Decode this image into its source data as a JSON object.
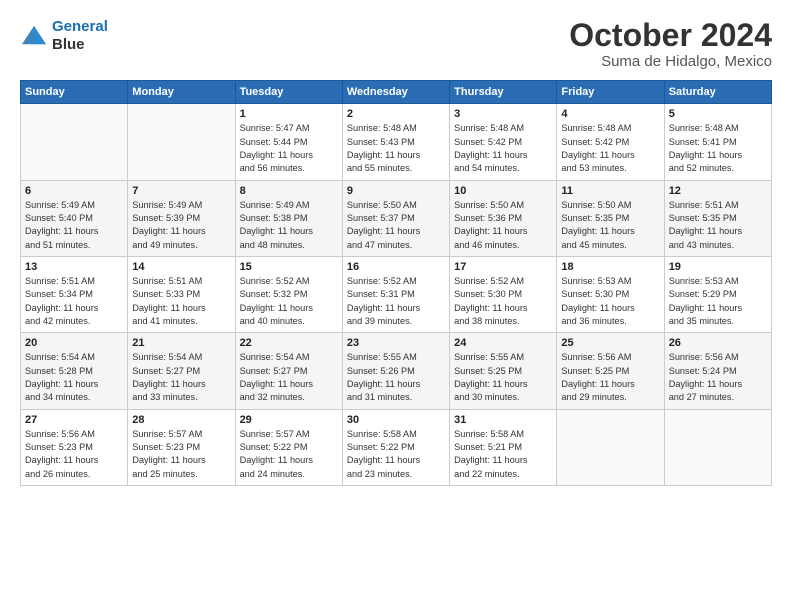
{
  "header": {
    "logo_line1": "General",
    "logo_line2": "Blue",
    "month": "October 2024",
    "location": "Suma de Hidalgo, Mexico"
  },
  "columns": [
    "Sunday",
    "Monday",
    "Tuesday",
    "Wednesday",
    "Thursday",
    "Friday",
    "Saturday"
  ],
  "weeks": [
    [
      {
        "num": "",
        "info": ""
      },
      {
        "num": "",
        "info": ""
      },
      {
        "num": "1",
        "info": "Sunrise: 5:47 AM\nSunset: 5:44 PM\nDaylight: 11 hours\nand 56 minutes."
      },
      {
        "num": "2",
        "info": "Sunrise: 5:48 AM\nSunset: 5:43 PM\nDaylight: 11 hours\nand 55 minutes."
      },
      {
        "num": "3",
        "info": "Sunrise: 5:48 AM\nSunset: 5:42 PM\nDaylight: 11 hours\nand 54 minutes."
      },
      {
        "num": "4",
        "info": "Sunrise: 5:48 AM\nSunset: 5:42 PM\nDaylight: 11 hours\nand 53 minutes."
      },
      {
        "num": "5",
        "info": "Sunrise: 5:48 AM\nSunset: 5:41 PM\nDaylight: 11 hours\nand 52 minutes."
      }
    ],
    [
      {
        "num": "6",
        "info": "Sunrise: 5:49 AM\nSunset: 5:40 PM\nDaylight: 11 hours\nand 51 minutes."
      },
      {
        "num": "7",
        "info": "Sunrise: 5:49 AM\nSunset: 5:39 PM\nDaylight: 11 hours\nand 49 minutes."
      },
      {
        "num": "8",
        "info": "Sunrise: 5:49 AM\nSunset: 5:38 PM\nDaylight: 11 hours\nand 48 minutes."
      },
      {
        "num": "9",
        "info": "Sunrise: 5:50 AM\nSunset: 5:37 PM\nDaylight: 11 hours\nand 47 minutes."
      },
      {
        "num": "10",
        "info": "Sunrise: 5:50 AM\nSunset: 5:36 PM\nDaylight: 11 hours\nand 46 minutes."
      },
      {
        "num": "11",
        "info": "Sunrise: 5:50 AM\nSunset: 5:35 PM\nDaylight: 11 hours\nand 45 minutes."
      },
      {
        "num": "12",
        "info": "Sunrise: 5:51 AM\nSunset: 5:35 PM\nDaylight: 11 hours\nand 43 minutes."
      }
    ],
    [
      {
        "num": "13",
        "info": "Sunrise: 5:51 AM\nSunset: 5:34 PM\nDaylight: 11 hours\nand 42 minutes."
      },
      {
        "num": "14",
        "info": "Sunrise: 5:51 AM\nSunset: 5:33 PM\nDaylight: 11 hours\nand 41 minutes."
      },
      {
        "num": "15",
        "info": "Sunrise: 5:52 AM\nSunset: 5:32 PM\nDaylight: 11 hours\nand 40 minutes."
      },
      {
        "num": "16",
        "info": "Sunrise: 5:52 AM\nSunset: 5:31 PM\nDaylight: 11 hours\nand 39 minutes."
      },
      {
        "num": "17",
        "info": "Sunrise: 5:52 AM\nSunset: 5:30 PM\nDaylight: 11 hours\nand 38 minutes."
      },
      {
        "num": "18",
        "info": "Sunrise: 5:53 AM\nSunset: 5:30 PM\nDaylight: 11 hours\nand 36 minutes."
      },
      {
        "num": "19",
        "info": "Sunrise: 5:53 AM\nSunset: 5:29 PM\nDaylight: 11 hours\nand 35 minutes."
      }
    ],
    [
      {
        "num": "20",
        "info": "Sunrise: 5:54 AM\nSunset: 5:28 PM\nDaylight: 11 hours\nand 34 minutes."
      },
      {
        "num": "21",
        "info": "Sunrise: 5:54 AM\nSunset: 5:27 PM\nDaylight: 11 hours\nand 33 minutes."
      },
      {
        "num": "22",
        "info": "Sunrise: 5:54 AM\nSunset: 5:27 PM\nDaylight: 11 hours\nand 32 minutes."
      },
      {
        "num": "23",
        "info": "Sunrise: 5:55 AM\nSunset: 5:26 PM\nDaylight: 11 hours\nand 31 minutes."
      },
      {
        "num": "24",
        "info": "Sunrise: 5:55 AM\nSunset: 5:25 PM\nDaylight: 11 hours\nand 30 minutes."
      },
      {
        "num": "25",
        "info": "Sunrise: 5:56 AM\nSunset: 5:25 PM\nDaylight: 11 hours\nand 29 minutes."
      },
      {
        "num": "26",
        "info": "Sunrise: 5:56 AM\nSunset: 5:24 PM\nDaylight: 11 hours\nand 27 minutes."
      }
    ],
    [
      {
        "num": "27",
        "info": "Sunrise: 5:56 AM\nSunset: 5:23 PM\nDaylight: 11 hours\nand 26 minutes."
      },
      {
        "num": "28",
        "info": "Sunrise: 5:57 AM\nSunset: 5:23 PM\nDaylight: 11 hours\nand 25 minutes."
      },
      {
        "num": "29",
        "info": "Sunrise: 5:57 AM\nSunset: 5:22 PM\nDaylight: 11 hours\nand 24 minutes."
      },
      {
        "num": "30",
        "info": "Sunrise: 5:58 AM\nSunset: 5:22 PM\nDaylight: 11 hours\nand 23 minutes."
      },
      {
        "num": "31",
        "info": "Sunrise: 5:58 AM\nSunset: 5:21 PM\nDaylight: 11 hours\nand 22 minutes."
      },
      {
        "num": "",
        "info": ""
      },
      {
        "num": "",
        "info": ""
      }
    ]
  ]
}
